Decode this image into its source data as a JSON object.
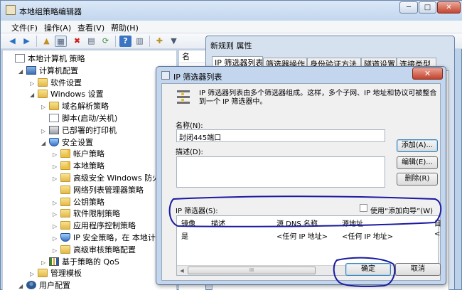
{
  "main_window": {
    "title": "本地组策略编辑器",
    "controls": {
      "minimize": "─",
      "maximize": "□",
      "close": "✕"
    },
    "menu": [
      "文件(F)",
      "操作(A)",
      "查看(V)",
      "帮助(H)"
    ],
    "toolbar_icons": [
      "back-icon",
      "forward-icon",
      "up-folder-icon",
      "show-hide-tree-icon",
      "delete-icon",
      "export-icon",
      "refresh-icon",
      "help-icon",
      "properties-icon",
      "add-icon",
      "filter-icon"
    ],
    "tree": [
      {
        "label": "本地计算机 策略",
        "icon": "doc",
        "expander": "",
        "level": 0
      },
      {
        "label": "计算机配置",
        "icon": "computer",
        "expander": "◢",
        "level": 1
      },
      {
        "label": "软件设置",
        "icon": "folder",
        "expander": "▷",
        "level": 2
      },
      {
        "label": "Windows 设置",
        "icon": "folder",
        "expander": "◢",
        "level": 2
      },
      {
        "label": "域名解析策略",
        "icon": "folder",
        "expander": "▷",
        "level": 3
      },
      {
        "label": "脚本(启动/关机)",
        "icon": "doc",
        "expander": "",
        "level": 3
      },
      {
        "label": "已部署的打印机",
        "icon": "printer",
        "expander": "▷",
        "level": 3
      },
      {
        "label": "安全设置",
        "icon": "shield",
        "expander": "◢",
        "level": 3
      },
      {
        "label": "帐户策略",
        "icon": "folder lock",
        "expander": "▷",
        "level": 4
      },
      {
        "label": "本地策略",
        "icon": "folder lock",
        "expander": "▷",
        "level": 4
      },
      {
        "label": "高级安全 Windows 防火墙",
        "icon": "folder",
        "expander": "▷",
        "level": 4
      },
      {
        "label": "网络列表管理器策略",
        "icon": "folder",
        "expander": "",
        "level": 4
      },
      {
        "label": "公钥策略",
        "icon": "folder",
        "expander": "▷",
        "level": 4
      },
      {
        "label": "软件限制策略",
        "icon": "folder",
        "expander": "▷",
        "level": 4
      },
      {
        "label": "应用程序控制策略",
        "icon": "folder",
        "expander": "▷",
        "level": 4
      },
      {
        "label": "IP 安全策略，在 本地计算机",
        "icon": "shield",
        "expander": "▷",
        "level": 4
      },
      {
        "label": "高级审核策略配置",
        "icon": "folder",
        "expander": "▷",
        "level": 4
      },
      {
        "label": "基于策略的 QoS",
        "icon": "chart",
        "expander": "▷",
        "level": 3
      },
      {
        "label": "管理模板",
        "icon": "folder",
        "expander": "▷",
        "level": 2
      },
      {
        "label": "用户配置",
        "icon": "user",
        "expander": "◢",
        "level": 1
      }
    ],
    "right_col_header": "名"
  },
  "props_dialog": {
    "title": "新规则 属性",
    "tabs": [
      "IP 筛选器列表",
      "筛选器操作",
      "身份验证方法",
      "隧道设置",
      "连接类型"
    ]
  },
  "ip_dialog": {
    "title": "IP 筛选器列表",
    "close": "✕",
    "description": "IP 筛选器列表由多个筛选器组成。这样，多个子网、IP 地址和协议可被整合到一个 IP 筛选器中。",
    "name_label": "名称(N):",
    "name_value": "封闭445端口",
    "desc_label": "描述(D):",
    "desc_value": "",
    "buttons": {
      "add": "添加(A)...",
      "edit": "编辑(E)...",
      "remove": "删除(R)",
      "ok": "确定",
      "cancel": "取消"
    },
    "filters_label": "IP 筛选器(S):",
    "wizard_label": "使用“添加向导”(W)",
    "wizard_checked": false,
    "table": {
      "headers": [
        "镜像",
        "描述",
        "源 DNS 名称",
        "源地址",
        "目"
      ],
      "rows": [
        [
          "是",
          "",
          "<任何 IP 地址>",
          "<任何 IP 地址>",
          "<"
        ]
      ]
    },
    "scroll_thumb": "III"
  },
  "annotation_color": "#1a1aa0"
}
